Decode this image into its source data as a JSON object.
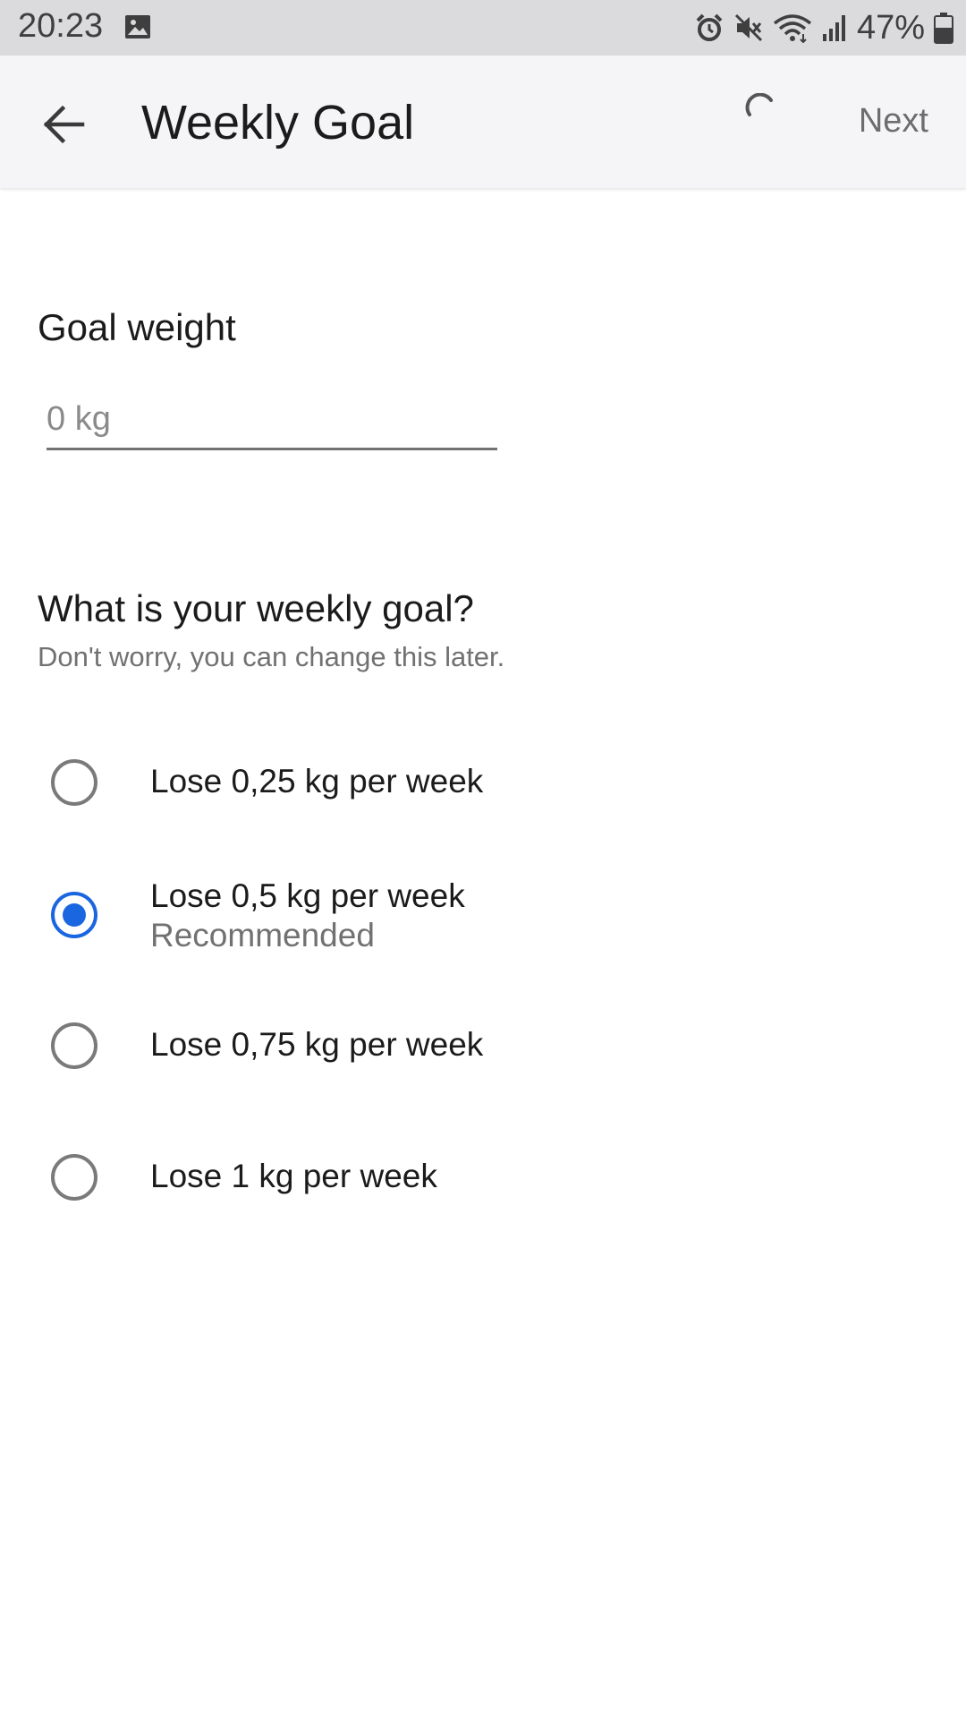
{
  "status_bar": {
    "time": "20:23",
    "battery": "47%",
    "icons": [
      "gallery-icon",
      "alarm-icon",
      "mute-icon",
      "wifi-icon",
      "signal-icon",
      "battery-icon"
    ]
  },
  "app_bar": {
    "title": "Weekly Goal",
    "next_label": "Next",
    "back_icon": "arrow-left-icon"
  },
  "goal_weight": {
    "label": "Goal weight",
    "placeholder": "0 kg",
    "value": ""
  },
  "weekly_goal": {
    "question": "What is your weekly goal?",
    "subtext": "Don't worry, you can change this later.",
    "options": [
      {
        "label": "Lose 0,25 kg per week",
        "sub": "",
        "selected": false
      },
      {
        "label": "Lose 0,5 kg per week",
        "sub": "Recommended",
        "selected": true
      },
      {
        "label": "Lose 0,75 kg per week",
        "sub": "",
        "selected": false
      },
      {
        "label": "Lose 1 kg per week",
        "sub": "",
        "selected": false
      }
    ]
  },
  "colors": {
    "accent": "#1a66e0",
    "app_bar_bg": "#f5f5f7",
    "status_bar_bg": "#dbdbdd",
    "secondary_text": "#717171"
  }
}
